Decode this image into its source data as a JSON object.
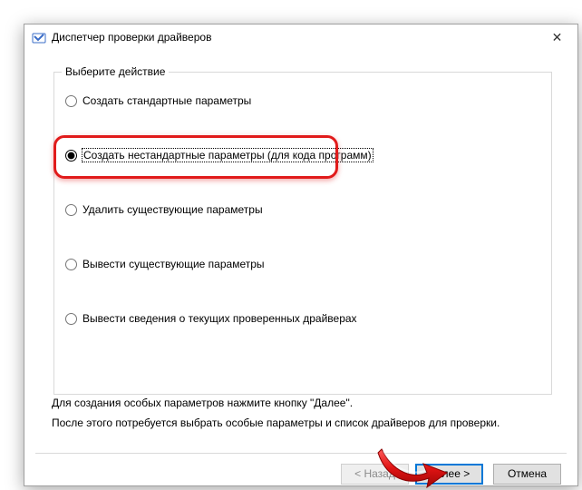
{
  "window": {
    "title": "Диспетчер проверки драйверов"
  },
  "group": {
    "caption": "Выберите действие",
    "options": {
      "create_standard": "Создать стандартные параметры",
      "create_custom": "Создать нестандартные параметры (для кода программ)",
      "delete_existing": "Удалить существующие параметры",
      "show_existing": "Вывести существующие параметры",
      "show_info": "Вывести сведения о текущих проверенных драйверах"
    }
  },
  "help": {
    "line1": "Для создания особых параметров нажмите кнопку \"Далее\".",
    "line2": "После этого потребуется выбрать особые параметры и список драйверов для проверки."
  },
  "buttons": {
    "back": "< Назад",
    "next": "Далее >",
    "cancel": "Отмена"
  }
}
